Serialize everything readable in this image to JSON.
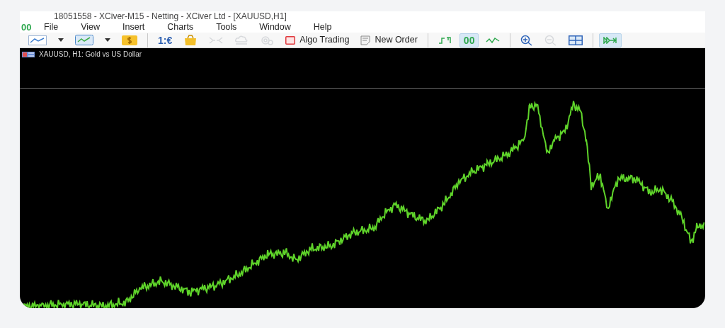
{
  "window": {
    "title": "18051558 - XCiver-M15 - Netting - XCiver Ltd - [XAUUSD,H1]"
  },
  "menu": {
    "badge": "00",
    "items": [
      "File",
      "View",
      "Insert",
      "Charts",
      "Tools",
      "Window",
      "Help"
    ]
  },
  "toolbar": [
    {
      "kind": "line-chart",
      "selected": false,
      "disabled": false
    },
    {
      "kind": "caret",
      "selected": false,
      "disabled": false
    },
    {
      "kind": "chart-window",
      "selected": false,
      "disabled": false
    },
    {
      "kind": "caret",
      "selected": false,
      "disabled": false
    },
    {
      "kind": "dollar",
      "selected": false,
      "disabled": false
    },
    {
      "kind": "separator"
    },
    {
      "kind": "text",
      "label": "1:€",
      "selected": false,
      "disabled": false
    },
    {
      "kind": "bag",
      "selected": false,
      "disabled": false
    },
    {
      "kind": "arrows",
      "selected": false,
      "disabled": true
    },
    {
      "kind": "cloud",
      "selected": false,
      "disabled": true
    },
    {
      "kind": "gear",
      "selected": false,
      "disabled": true
    },
    {
      "kind": "algo",
      "label": "Algo Trading",
      "selected": false,
      "disabled": false
    },
    {
      "kind": "order",
      "label": "New Order",
      "selected": false,
      "disabled": false
    },
    {
      "kind": "separator"
    },
    {
      "kind": "step",
      "selected": false,
      "disabled": false
    },
    {
      "kind": "text",
      "label": "00",
      "selected": true,
      "disabled": false
    },
    {
      "kind": "wave",
      "selected": false,
      "disabled": false
    },
    {
      "kind": "separator"
    },
    {
      "kind": "zoom-in",
      "selected": false,
      "disabled": false
    },
    {
      "kind": "zoom-out",
      "selected": false,
      "disabled": true
    },
    {
      "kind": "tiles",
      "selected": false,
      "disabled": false
    },
    {
      "kind": "separator"
    },
    {
      "kind": "autoscroll",
      "selected": true,
      "disabled": false
    }
  ],
  "chart": {
    "title": "XAUUSD, H1:  Gold vs US Dollar"
  }
}
